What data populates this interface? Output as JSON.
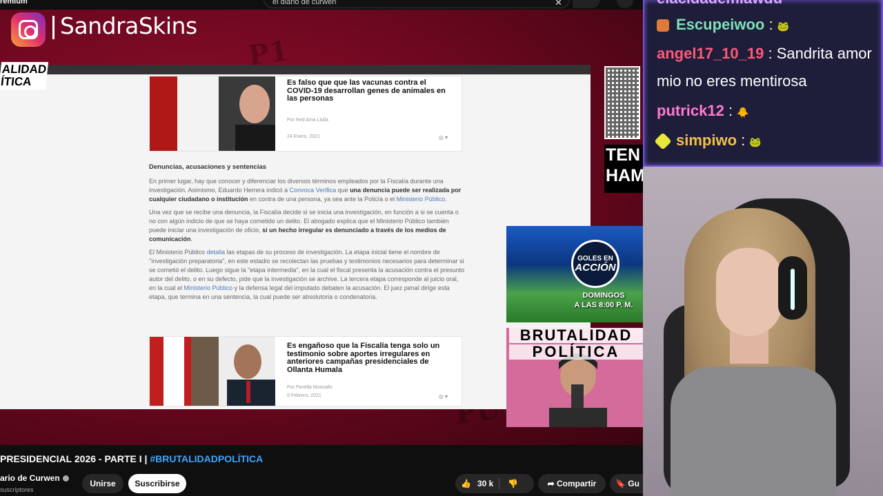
{
  "yt_top": {
    "brand": "remium",
    "search_value": "el diario de curwen"
  },
  "overlay": {
    "instagram_handle": "SandraSkins",
    "side_label_1": "ALIDAD",
    "side_label_2": "ÍTICA"
  },
  "article": {
    "card1": {
      "title": "Es falso que que las vacunas contra el COVID-19 desarrollan genes de animales en las personas",
      "author": "Por Red Ama Llulla",
      "date": "24 Enero, 2021"
    },
    "section_heading": "Denuncias, acusaciones y sentencias",
    "p1_a": "En primer lugar, hay que conocer y diferenciar los diversos términos empleados por la Fiscalía durante una investigación. Asimismo, Eduardo Herrera indicó a ",
    "p1_link": "Convoca Verifica",
    "p1_b": " que ",
    "p1_bold": "una denuncia puede ser realizada por cualquier ciudadano o institución",
    "p1_c": " en contra de una persona, ya sea ante la Policía o el ",
    "p1_link2": "Ministerio Público",
    "p1_d": ".",
    "p2_a": "Una vez que se recibe una denuncia, la Fiscalía decide si se inicia una investigación, en función a si se cuenta o no con algún indicio de que se haya cometido un delito. El abogado explica que el Ministerio Público también puede iniciar una investigación de oficio, ",
    "p2_bold": "si un hecho irregular es denunciado a través de los medios de comunicación",
    "p2_b": ".",
    "p3_a": "El Ministerio Público ",
    "p3_link": "detalla",
    "p3_b": " las etapas de su proceso de investigación. La etapa inicial tiene el nombre de \"investigación preparatoria\", en este estadio se recolectan las pruebas y testimonios necesarios para determinar si se cometió el delito. Luego sigue la \"etapa intermedia\", en la cual el fiscal presenta la acusación contra el presunto autor del delito, o en su defecto, pide que la investigación se archive. La tercera etapa corresponde al juicio oral, en la cual el ",
    "p3_link2": "Ministerio Público",
    "p3_c": " y la defensa legal del imputado debaten la acusación. El juez penal dirige esta etapa, que termina en una sentencia, la cual puede ser absolutoria o condenatoria.",
    "card2": {
      "title": "Es engañoso que la Fiscalía tenga solo un testimonio sobre aportes irregulares en anteriores campañas presidenciales de Ollanta Humala",
      "author": "Por Fiorella Moncallo",
      "date": "5 Febrero, 2021"
    }
  },
  "side_panels": {
    "tem_text": "TEN HAM",
    "goles_logo_top": "GOLES EN",
    "goles_logo_big": "ACCIÓN",
    "goles_schedule_1": "DOMINGOS",
    "goles_schedule_2": "A LAS 8:00 P. M.",
    "bp_title_1": "BRUTALIDAD",
    "bp_title_2": "POLÍTICA"
  },
  "yt_bottom": {
    "video_title": "PRESIDENCIAL 2026 - PARTE I | ",
    "video_hashtag": "#BRUTALIDADPOLÍTICA",
    "channel_name": "ario de Curwen",
    "subscribers": "suscriptores",
    "join_label": "Unirse",
    "subscribe_label": "Suscribirse",
    "likes": "30 k",
    "share_label": "Compartir",
    "save_label": "Gu"
  },
  "chat": {
    "messages": [
      {
        "user": "elacidademiawdu",
        "text": "",
        "color": "#d9a7ff"
      },
      {
        "user": "Escupeiwoo",
        "text": "",
        "color": "#7ee0b8"
      },
      {
        "user": "angel17_10_19",
        "text": "Sandrita amor mio no eres mentirosa",
        "color": "#ff5a7a"
      },
      {
        "user": "putrick12",
        "text": "",
        "color": "#ff7ad0"
      },
      {
        "user": "simpiwo",
        "text": "",
        "color": "#f2c14a"
      }
    ]
  },
  "colors": {
    "youtube_bg": "#0f0f0f",
    "video_red": "#9a1030",
    "chat_border": "#6f55d0",
    "link_blue": "#3ea6ff"
  }
}
